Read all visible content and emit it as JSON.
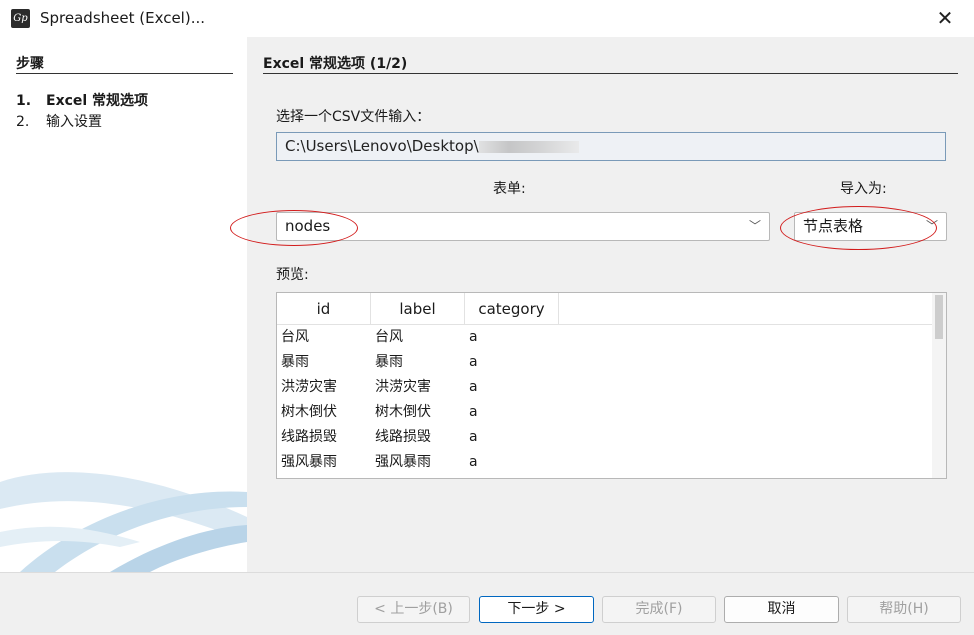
{
  "window": {
    "title": "Spreadsheet (Excel)..."
  },
  "sidebar": {
    "title": "步骤",
    "steps": [
      {
        "num": "1.",
        "label": "Excel 常规选项"
      },
      {
        "num": "2.",
        "label": "输入设置"
      }
    ]
  },
  "main": {
    "section_title": "Excel 常规选项 (1/2)",
    "csv_label": "选择一个CSV文件输入：",
    "file_path": "C:\\Users\\Lenovo\\Desktop\\",
    "sheet_label": "表单:",
    "import_label": "导入为:",
    "sheet_value": "nodes",
    "import_value": "节点表格",
    "preview_label": "预览:",
    "preview": {
      "columns": [
        "id",
        "label",
        "category"
      ],
      "rows": [
        [
          "台风",
          "台风",
          "a"
        ],
        [
          "暴雨",
          "暴雨",
          "a"
        ],
        [
          "洪涝灾害",
          "洪涝灾害",
          "a"
        ],
        [
          "树木倒伏",
          "树木倒伏",
          "a"
        ],
        [
          "线路损毁",
          "线路损毁",
          "a"
        ],
        [
          "强风暴雨",
          "强风暴雨",
          "a"
        ]
      ]
    }
  },
  "footer": {
    "back": "< 上一步(B)",
    "next": "下一步 >",
    "finish": "完成(F)",
    "cancel": "取消",
    "help": "帮助(H)"
  }
}
